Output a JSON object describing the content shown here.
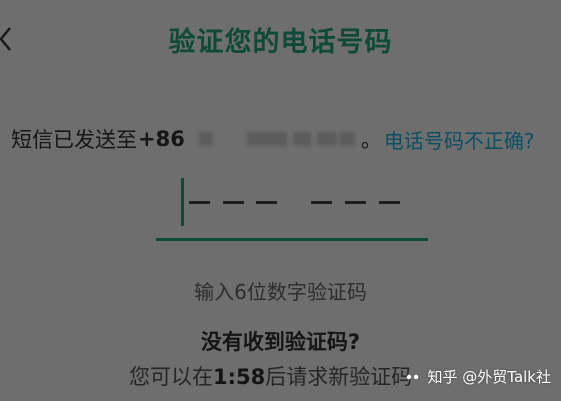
{
  "header": {
    "title": "验证您的电话号码"
  },
  "sms": {
    "prefix": "短信已发送至",
    "country_code": "+86",
    "separator": "。",
    "wrong_number_link": "电话号码不正确?"
  },
  "code_input": {
    "length": 6,
    "hint": "输入6位数字验证码"
  },
  "resend": {
    "heading": "没有收到验证码?",
    "before_timer": "您可以在",
    "timer": "1:58",
    "after_timer": "后请求新验证码"
  },
  "watermark": {
    "text": "知乎 @外贸Talk社"
  },
  "colors": {
    "accent": "#0f4a38",
    "link": "#0c4f63",
    "overlay": "#6e6e6e"
  }
}
